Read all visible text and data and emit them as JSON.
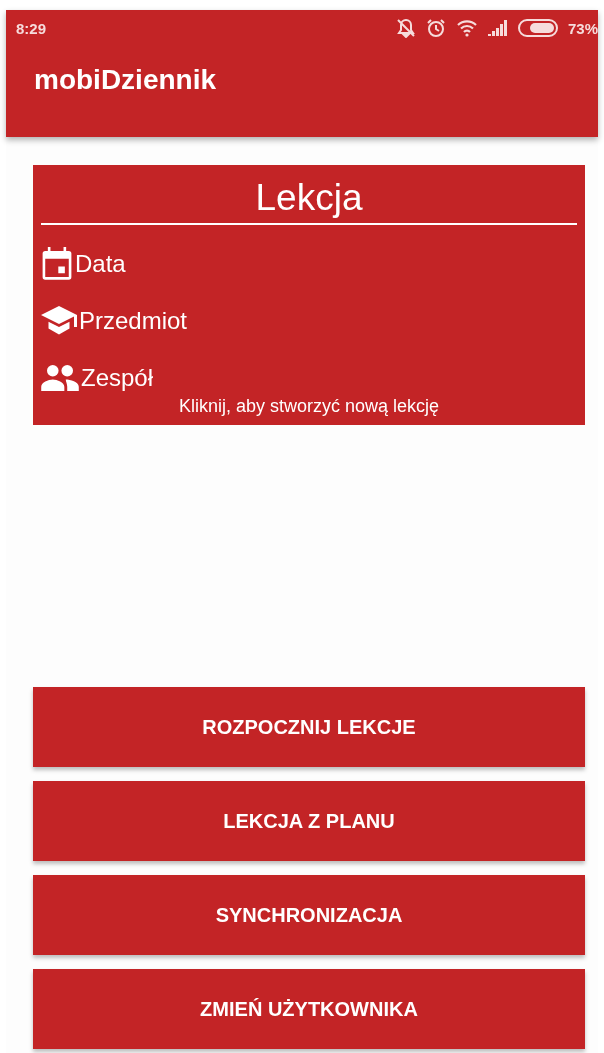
{
  "status_bar": {
    "time": "8:29",
    "battery_text": "73%"
  },
  "app_bar": {
    "title": "mobiDziennik"
  },
  "lesson_card": {
    "title": "Lekcja",
    "fields": [
      {
        "kind": "calendar",
        "label": "Data"
      },
      {
        "kind": "cap",
        "label": "Przedmiot"
      },
      {
        "kind": "people",
        "label": "Zespół"
      }
    ],
    "hint": "Kliknij, aby stworzyć nową lekcję"
  },
  "buttons": [
    "ROZPOCZNIJ LEKCJE",
    "LEKCJA Z PLANU",
    "SYNCHRONIZACJA",
    "ZMIEŃ UŻYTKOWNIKA"
  ]
}
